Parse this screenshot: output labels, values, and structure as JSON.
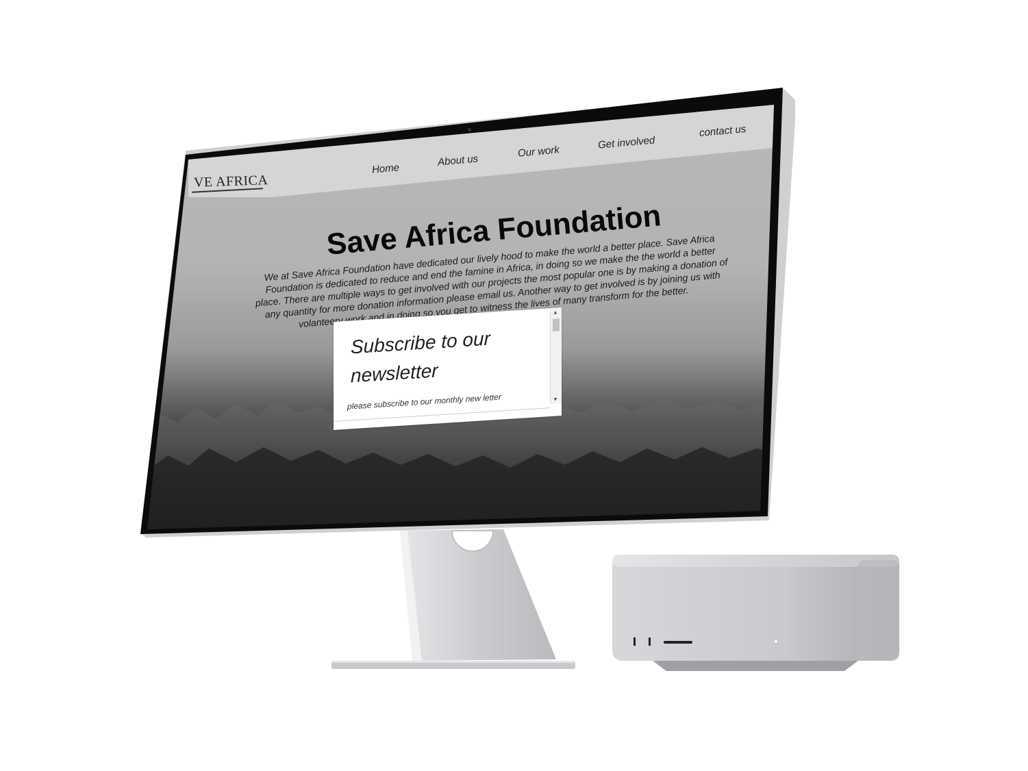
{
  "site": {
    "logo_text": "VE AFRICA",
    "nav": {
      "home": "Home",
      "about": "About us",
      "work": "Our work",
      "involved": "Get involved",
      "contact": "contact us"
    },
    "hero": {
      "title": "Save Africa Foundation",
      "body": "We at Save Africa Foundation have dedicated our lively hood to make the world a better place. Save Africa Foundation is dedicated to reduce and end the famine in Africa, in doing so we make the the world a better place. There are multiple ways to get involved with our projects the most popular one is by making a donation of any quantity for more donation information please email us. Another way to get involved is by joining us with volanteery work and in doing so you get to witness the lives of many transform for the better."
    },
    "newsletter": {
      "title": "Subscribe to our newsletter",
      "subtitle": "please subscribe to our monthly new letter"
    }
  },
  "colors": {
    "navbar": "#d6d5d3",
    "bezel": "#0b0b0b",
    "aluminium": "#d2d3d6"
  }
}
